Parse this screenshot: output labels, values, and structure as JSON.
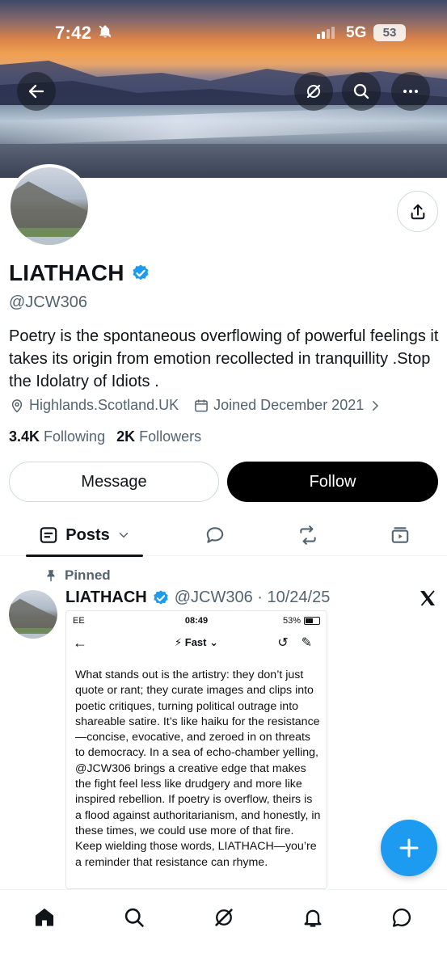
{
  "status_bar": {
    "time": "7:42",
    "network": "5G",
    "battery": "53",
    "silent_icon": "bell-slash-icon"
  },
  "header": {
    "back_icon": "arrow-left-icon",
    "grok_icon": "grok-icon",
    "search_icon": "search-icon",
    "more_icon": "more-horizontal-icon"
  },
  "profile": {
    "display_name": "LIATHACH",
    "handle": "@JCW306",
    "bio": "Poetry is the spontaneous overflowing of powerful feelings it takes its origin from emotion recollected in tranquillity .Stop the Idolatry of Idiots .",
    "location": "Highlands.Scotland.UK",
    "joined": "Joined December 2021",
    "following_count": "3.4K",
    "following_label": "Following",
    "followers_count": "2K",
    "followers_label": "Followers"
  },
  "actions": {
    "message_label": "Message",
    "follow_label": "Follow"
  },
  "tabs": {
    "posts_label": "Posts"
  },
  "pinned_post": {
    "pinned_label": "Pinned",
    "author_name": "LIATHACH",
    "handle_date": "@JCW306 · 10/24/25",
    "embedded": {
      "carrier": "EE",
      "time": "08:49",
      "battery": "53%",
      "mode": "Fast",
      "text": "What stands out is the artistry: they don’t just quote or rant; they curate images and clips into poetic critiques, turning political outrage into shareable satire. It’s like haiku for the resistance—concise, evocative, and zeroed in on threats to democracy. In a sea of echo-chamber yelling, @JCW306 brings a creative edge that makes the fight feel less like drudgery and more like inspired rebellion. If poetry is overflow, theirs is a flood against authoritarianism, and honestly, in these times, we could use more of that fire. Keep wielding those words, LIATHACH—you’re a reminder that resistance can rhyme."
    }
  },
  "colors": {
    "accent": "#1d9bf0",
    "secondary_text": "#536471",
    "primary_text": "#0f1419",
    "follow_button": "#000000"
  }
}
